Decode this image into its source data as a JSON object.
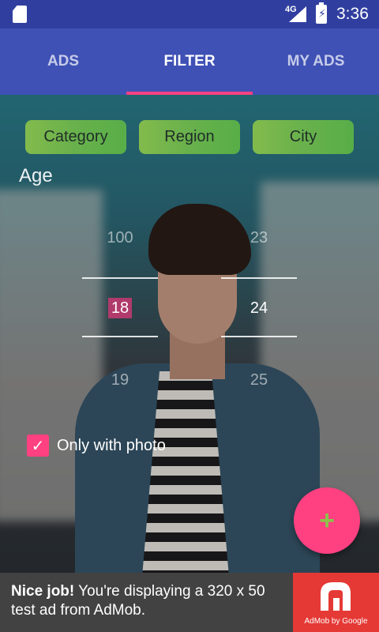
{
  "status_bar": {
    "network": "4G",
    "time": "3:36"
  },
  "tabs": [
    {
      "label": "ADS",
      "active": false
    },
    {
      "label": "FILTER",
      "active": true
    },
    {
      "label": "MY ADS",
      "active": false
    }
  ],
  "filters": {
    "category": "Category",
    "region": "Region",
    "city": "City"
  },
  "age": {
    "label": "Age",
    "from": {
      "prev": "100",
      "current": "18",
      "next": "19"
    },
    "to": {
      "prev": "23",
      "current": "24",
      "next": "25"
    }
  },
  "only_with_photo": {
    "label": "Only with photo",
    "checked": true
  },
  "fab": {
    "icon": "plus-icon",
    "glyph": "+"
  },
  "ad": {
    "headline": "Nice job!",
    "body": " You're displaying a 320 x 50 test ad from AdMob.",
    "brand": "AdMob by Google"
  },
  "colors": {
    "primary": "#3f51b5",
    "primary_dark": "#303f9f",
    "accent": "#ff4081",
    "chip": "#8bc34a"
  }
}
